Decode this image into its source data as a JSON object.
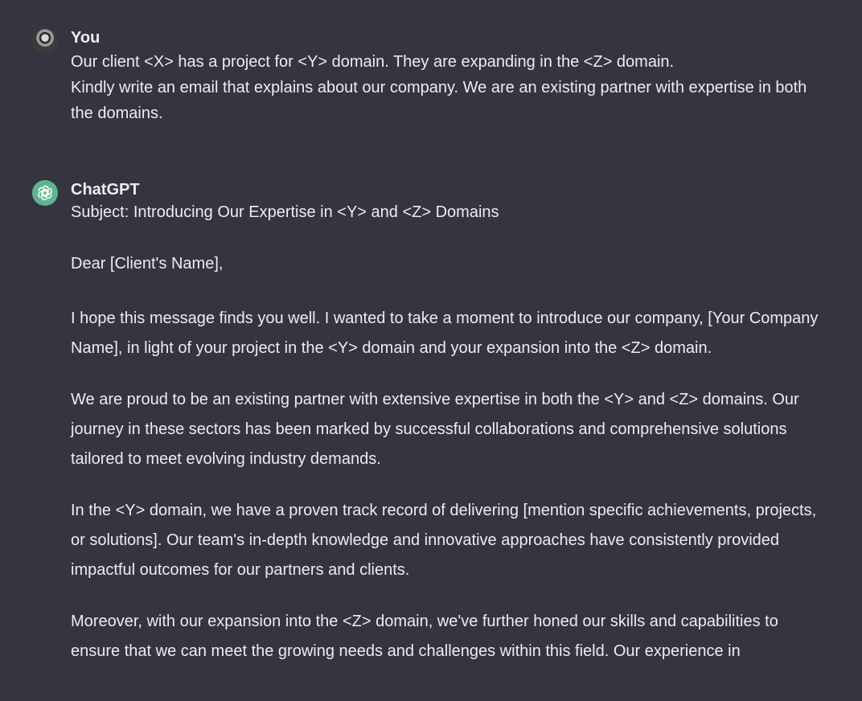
{
  "conversation": {
    "user": {
      "author": "You",
      "lines": [
        "Our client <X> has a project for <Y> domain. They are expanding in the <Z> domain.",
        "Kindly write an email that explains about our company. We are an existing partner with expertise in both the domains."
      ]
    },
    "assistant": {
      "author": "ChatGPT",
      "paragraphs": [
        "Subject: Introducing Our Expertise in <Y> and <Z> Domains",
        "Dear [Client's Name],",
        "I hope this message finds you well. I wanted to take a moment to introduce our company, [Your Company Name], in light of your project in the <Y> domain and your expansion into the <Z> domain.",
        "We are proud to be an existing partner with extensive expertise in both the <Y> and <Z> domains. Our journey in these sectors has been marked by successful collaborations and comprehensive solutions tailored to meet evolving industry demands.",
        "In the <Y> domain, we have a proven track record of delivering [mention specific achievements, projects, or solutions]. Our team's in-depth knowledge and innovative approaches have consistently provided impactful outcomes for our partners and clients.",
        "Moreover, with our expansion into the <Z> domain, we've further honed our skills and capabilities to ensure that we can meet the growing needs and challenges within this field. Our experience in"
      ]
    }
  },
  "icons": {
    "user_avatar": "user-avatar-icon",
    "assistant_avatar": "openai-logo-icon"
  },
  "colors": {
    "background": "#343541",
    "text": "#ececf1",
    "assistant_avatar_bg": "#5fb48f"
  }
}
